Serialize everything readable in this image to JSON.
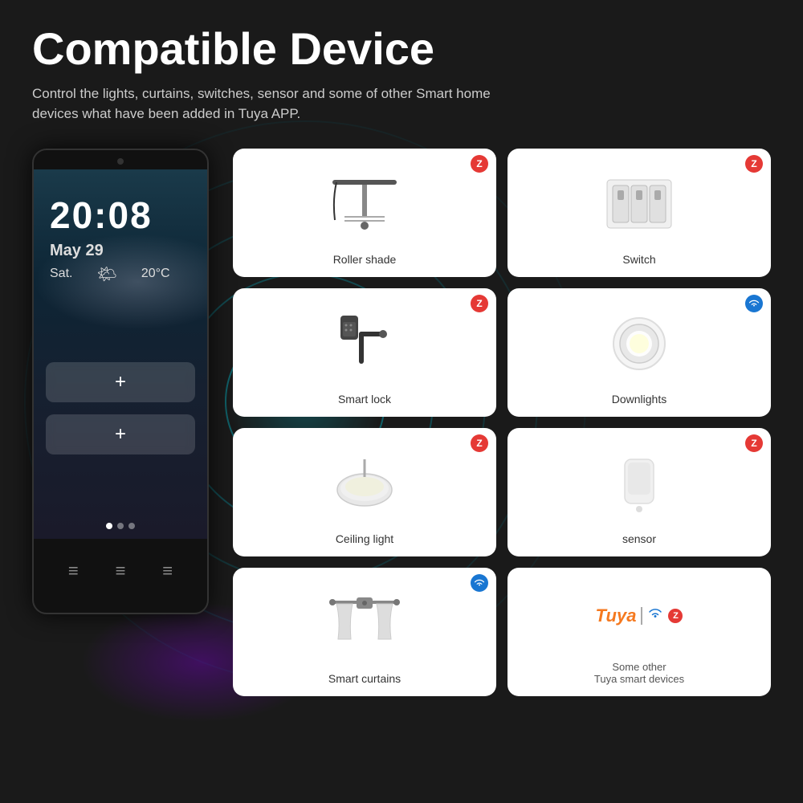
{
  "page": {
    "title": "Compatible Device",
    "subtitle": "Control the lights, curtains, switches, sensor and some of other Smart home devices what have been added in Tuya APP.",
    "background_color": "#1a1a1a"
  },
  "panel": {
    "time": "20:08",
    "date": "May 29",
    "day": "Sat.",
    "temp": "20°C",
    "btn1_label": "+",
    "btn2_label": "+"
  },
  "devices": [
    {
      "id": "roller-shade",
      "label": "Roller shade",
      "badge": "zigbee",
      "icon_type": "roller-shade"
    },
    {
      "id": "switch",
      "label": "Switch",
      "badge": "zigbee",
      "icon_type": "switch"
    },
    {
      "id": "smart-lock",
      "label": "Smart lock",
      "badge": "zigbee",
      "icon_type": "smart-lock"
    },
    {
      "id": "downlights",
      "label": "Downlights",
      "badge": "wifi",
      "icon_type": "downlights"
    },
    {
      "id": "ceiling-light",
      "label": "Ceiling light",
      "badge": "zigbee",
      "icon_type": "ceiling-light"
    },
    {
      "id": "sensor",
      "label": "sensor",
      "badge": "zigbee",
      "icon_type": "sensor"
    },
    {
      "id": "smart-curtains",
      "label": "Smart curtains",
      "badge": "wifi",
      "icon_type": "smart-curtains"
    },
    {
      "id": "tuya-devices",
      "label": "Some other\nTuya smart devices",
      "badge": null,
      "icon_type": "tuya"
    }
  ]
}
